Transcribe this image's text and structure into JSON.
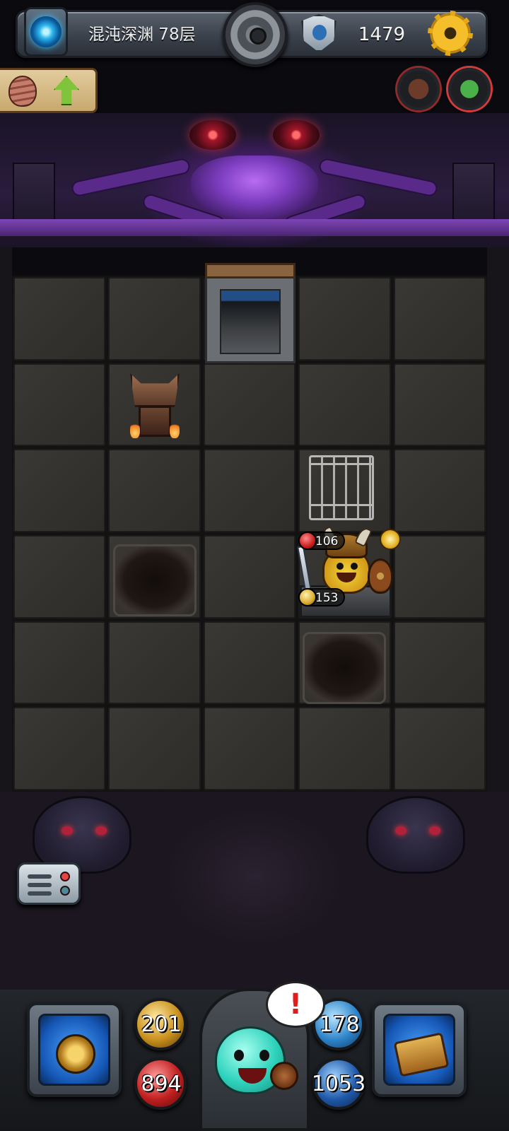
{
  "hud": {
    "floor_label": "混沌深渊 78层",
    "gem_count": "1479",
    "icons": [
      "portal-icon",
      "medal-icon",
      "crest-icon",
      "gear-icon",
      "mummy-icon",
      "up-arrow-icon",
      "brain-buff-icon",
      "goblin-buff-icon"
    ]
  },
  "board": {
    "hero": {
      "hp": "106",
      "attack": "153"
    }
  },
  "player_stats": {
    "attack": "201",
    "hp": "894",
    "defense": "178",
    "mana": "1053"
  },
  "pet": {
    "alert": "!"
  },
  "colors": {
    "accent_purple": "#7d45b6",
    "hp_red": "#c81e1e",
    "gold": "#e4b020",
    "mana_blue": "#2059a8",
    "pet_teal": "#2fd3bd"
  }
}
